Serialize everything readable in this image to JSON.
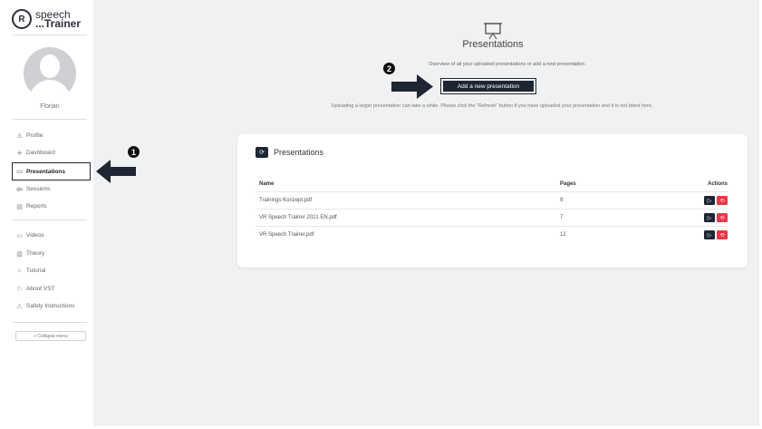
{
  "brand": {
    "mark": "R",
    "name_line1": "speech",
    "name_line2": "...Trainer"
  },
  "user": {
    "name": "Florian"
  },
  "sidebar": {
    "items": [
      {
        "label": "Profile",
        "icon": "person-icon",
        "glyph": "♙"
      },
      {
        "label": "Dashboard",
        "icon": "dashboard-icon",
        "glyph": "⁜"
      },
      {
        "label": "Presentations",
        "icon": "presentation-icon",
        "glyph": "▭",
        "active": true
      },
      {
        "label": "Sessions",
        "icon": "sessions-icon",
        "glyph": "⟴"
      },
      {
        "label": "Reports",
        "icon": "reports-icon",
        "glyph": "▤"
      },
      {
        "label": "Videos",
        "icon": "video-icon",
        "glyph": "▭"
      },
      {
        "label": "Theory",
        "icon": "book-icon",
        "glyph": "▥"
      },
      {
        "label": "Tutorial",
        "icon": "tutorial-icon",
        "glyph": "⌂"
      },
      {
        "label": "About VST",
        "icon": "info-icon",
        "glyph": "⚐"
      },
      {
        "label": "Safety Instructions",
        "icon": "warning-icon",
        "glyph": "⚠"
      }
    ],
    "collapse_label": "« Collapse menu"
  },
  "header": {
    "title": "Presentations",
    "intro": "Overview of all your uploaded presentations or add a new presentation.",
    "add_button": "Add a new presentation",
    "upload_note": "Uploading a larger presentation can take a while. Please click the \"Refresh\" button if you have uploaded your presentation and it is not listed here."
  },
  "annotations": {
    "step1": "1",
    "step2": "2"
  },
  "card": {
    "title": "Presentations",
    "refresh_icon": "refresh-icon",
    "columns": {
      "name": "Name",
      "pages": "Pages",
      "actions": "Actions"
    },
    "rows": [
      {
        "name": "Trainings Konzept.pdf",
        "pages": "9"
      },
      {
        "name": "VR Speech Trainer 2021 EN.pdf",
        "pages": "7"
      },
      {
        "name": "VR Speech Trainer.pdf",
        "pages": "12"
      }
    ],
    "play_glyph": "▷",
    "delete_glyph": "⟲"
  },
  "colors": {
    "dark": "#1f2633",
    "danger": "#e63946",
    "background": "#f0f1f3"
  }
}
